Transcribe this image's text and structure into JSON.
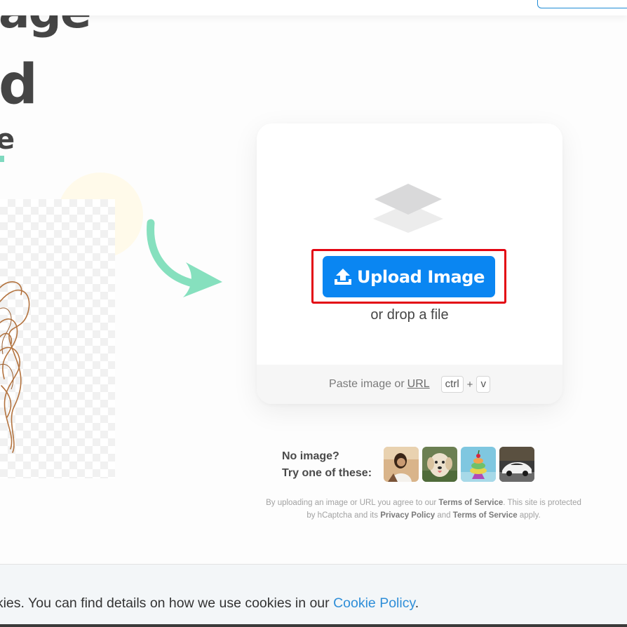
{
  "hero": {
    "headline_line1": "age",
    "headline_line2": "d",
    "subheadline": "e"
  },
  "upload": {
    "button_label": "Upload Image",
    "button_icon": "upload-icon",
    "drop_text": "or drop a file",
    "paste_text": "Paste image or",
    "url_link": "URL",
    "key_ctrl": "ctrl",
    "key_plus": "+",
    "key_v": "v"
  },
  "samples": {
    "prompt_line1": "No image?",
    "prompt_line2": "Try one of these:",
    "thumbnails": [
      "sample-woman",
      "sample-dog",
      "sample-cake",
      "sample-car"
    ]
  },
  "legal": {
    "part1": "By uploading an image or URL you agree to our",
    "terms_link": "Terms of Service",
    "part2": ". This site is protected by hCaptcha and its",
    "privacy_link": "Privacy Policy",
    "part3": "and",
    "terms_link2": "Terms of Service",
    "part4": "apply."
  },
  "cookie": {
    "text": "okies. You can find details on how we use cookies in our",
    "link": "Cookie Policy",
    "end": "."
  },
  "colors": {
    "accent": "#0a86f2",
    "highlight": "#e30613",
    "arrow": "#86e0be",
    "link": "#2e8ed8"
  }
}
